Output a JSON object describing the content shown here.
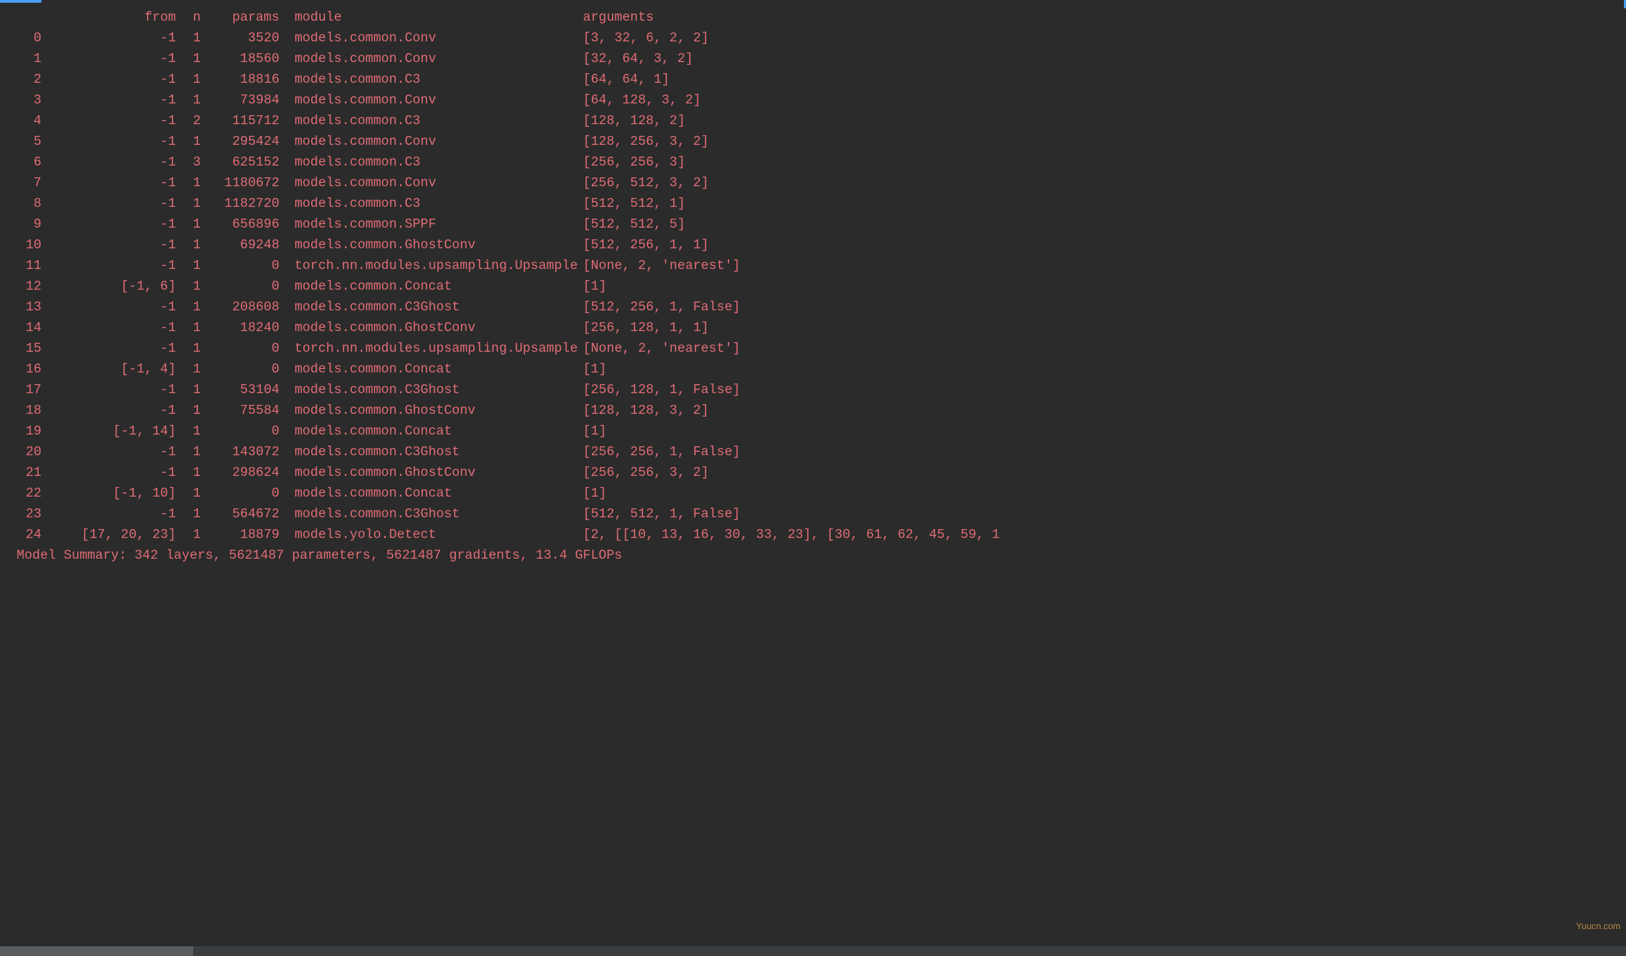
{
  "header": {
    "idx": "",
    "from": "from",
    "n": "n",
    "params": "params",
    "module": "module",
    "args": "arguments"
  },
  "rows": [
    {
      "idx": "0",
      "from": "-1",
      "n": "1",
      "params": "3520",
      "module": "models.common.Conv",
      "args": "[3, 32, 6, 2, 2]"
    },
    {
      "idx": "1",
      "from": "-1",
      "n": "1",
      "params": "18560",
      "module": "models.common.Conv",
      "args": "[32, 64, 3, 2]"
    },
    {
      "idx": "2",
      "from": "-1",
      "n": "1",
      "params": "18816",
      "module": "models.common.C3",
      "args": "[64, 64, 1]"
    },
    {
      "idx": "3",
      "from": "-1",
      "n": "1",
      "params": "73984",
      "module": "models.common.Conv",
      "args": "[64, 128, 3, 2]"
    },
    {
      "idx": "4",
      "from": "-1",
      "n": "2",
      "params": "115712",
      "module": "models.common.C3",
      "args": "[128, 128, 2]"
    },
    {
      "idx": "5",
      "from": "-1",
      "n": "1",
      "params": "295424",
      "module": "models.common.Conv",
      "args": "[128, 256, 3, 2]"
    },
    {
      "idx": "6",
      "from": "-1",
      "n": "3",
      "params": "625152",
      "module": "models.common.C3",
      "args": "[256, 256, 3]"
    },
    {
      "idx": "7",
      "from": "-1",
      "n": "1",
      "params": "1180672",
      "module": "models.common.Conv",
      "args": "[256, 512, 3, 2]"
    },
    {
      "idx": "8",
      "from": "-1",
      "n": "1",
      "params": "1182720",
      "module": "models.common.C3",
      "args": "[512, 512, 1]"
    },
    {
      "idx": "9",
      "from": "-1",
      "n": "1",
      "params": "656896",
      "module": "models.common.SPPF",
      "args": "[512, 512, 5]"
    },
    {
      "idx": "10",
      "from": "-1",
      "n": "1",
      "params": "69248",
      "module": "models.common.GhostConv",
      "args": "[512, 256, 1, 1]"
    },
    {
      "idx": "11",
      "from": "-1",
      "n": "1",
      "params": "0",
      "module": "torch.nn.modules.upsampling.Upsample",
      "args": "[None, 2, 'nearest']"
    },
    {
      "idx": "12",
      "from": "[-1, 6]",
      "n": "1",
      "params": "0",
      "module": "models.common.Concat",
      "args": "[1]"
    },
    {
      "idx": "13",
      "from": "-1",
      "n": "1",
      "params": "208608",
      "module": "models.common.C3Ghost",
      "args": "[512, 256, 1, False]"
    },
    {
      "idx": "14",
      "from": "-1",
      "n": "1",
      "params": "18240",
      "module": "models.common.GhostConv",
      "args": "[256, 128, 1, 1]"
    },
    {
      "idx": "15",
      "from": "-1",
      "n": "1",
      "params": "0",
      "module": "torch.nn.modules.upsampling.Upsample",
      "args": "[None, 2, 'nearest']"
    },
    {
      "idx": "16",
      "from": "[-1, 4]",
      "n": "1",
      "params": "0",
      "module": "models.common.Concat",
      "args": "[1]"
    },
    {
      "idx": "17",
      "from": "-1",
      "n": "1",
      "params": "53104",
      "module": "models.common.C3Ghost",
      "args": "[256, 128, 1, False]"
    },
    {
      "idx": "18",
      "from": "-1",
      "n": "1",
      "params": "75584",
      "module": "models.common.GhostConv",
      "args": "[128, 128, 3, 2]"
    },
    {
      "idx": "19",
      "from": "[-1, 14]",
      "n": "1",
      "params": "0",
      "module": "models.common.Concat",
      "args": "[1]"
    },
    {
      "idx": "20",
      "from": "-1",
      "n": "1",
      "params": "143072",
      "module": "models.common.C3Ghost",
      "args": "[256, 256, 1, False]"
    },
    {
      "idx": "21",
      "from": "-1",
      "n": "1",
      "params": "298624",
      "module": "models.common.GhostConv",
      "args": "[256, 256, 3, 2]"
    },
    {
      "idx": "22",
      "from": "[-1, 10]",
      "n": "1",
      "params": "0",
      "module": "models.common.Concat",
      "args": "[1]"
    },
    {
      "idx": "23",
      "from": "-1",
      "n": "1",
      "params": "564672",
      "module": "models.common.C3Ghost",
      "args": "[512, 512, 1, False]"
    },
    {
      "idx": "24",
      "from": "[17, 20, 23]",
      "n": "1",
      "params": "18879",
      "module": "models.yolo.Detect",
      "args": "[2, [[10, 13, 16, 30, 33, 23], [30, 61, 62, 45, 59, 1"
    }
  ],
  "summary": "Model Summary: 342 layers, 5621487 parameters, 5621487 gradients, 13.4 GFLOPs",
  "watermark": "Yuucn.com"
}
